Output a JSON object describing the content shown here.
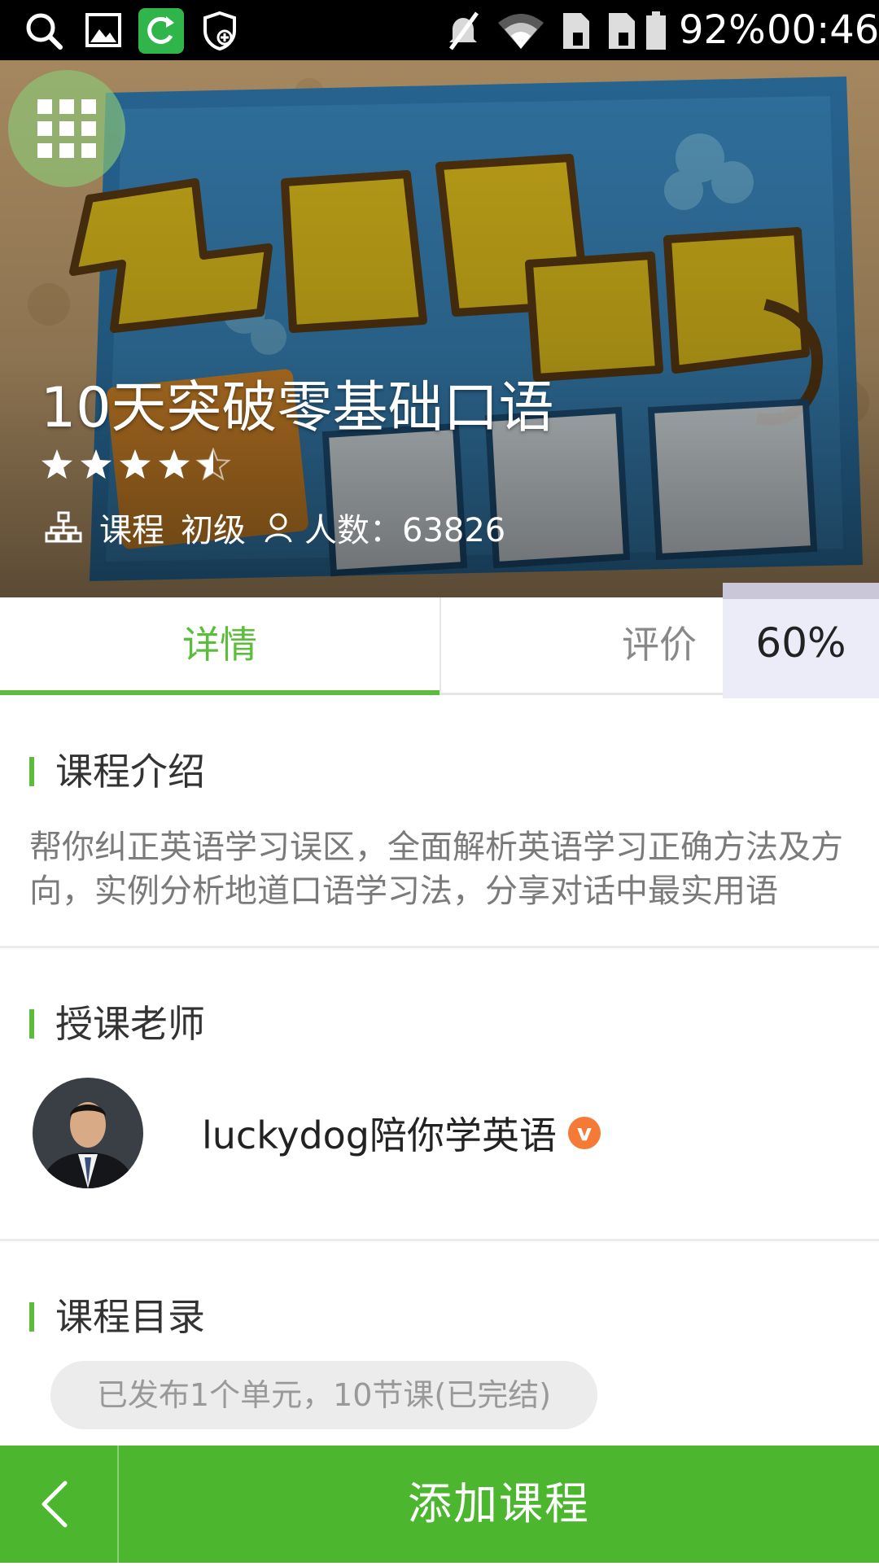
{
  "status_bar": {
    "battery": "92%",
    "time": "00:46",
    "icons": [
      "search-icon",
      "gallery-icon",
      "refresh-app-icon",
      "shield-icon",
      "mute-icon",
      "wifi-icon",
      "sim1-icon",
      "sim2-icon",
      "battery-icon"
    ]
  },
  "hero": {
    "title": "10天突破零基础口语",
    "rating": 4.5,
    "rating_max": 5,
    "category": "课程",
    "level": "初级",
    "enrolled_label": "人数：63826"
  },
  "tabs": {
    "details": "详情",
    "reviews": "评价",
    "progress": "60%"
  },
  "intro": {
    "heading": "课程介绍",
    "text": "帮你纠正英语学习误区，全面解析英语学习正确方法及方向，实例分析地道口语学习法，分享对话中最实用语"
  },
  "teacher": {
    "heading": "授课老师",
    "name": "luckydog陪你学英语",
    "verified_badge": "v"
  },
  "catalog": {
    "heading": "课程目录",
    "summary": "已发布1个单元，10节课(已完结)"
  },
  "bottom": {
    "add_label": "添加课程"
  },
  "colors": {
    "accent": "#5bbd3b",
    "bottom_bar": "#4cb62e",
    "badge": "#f47a36"
  }
}
